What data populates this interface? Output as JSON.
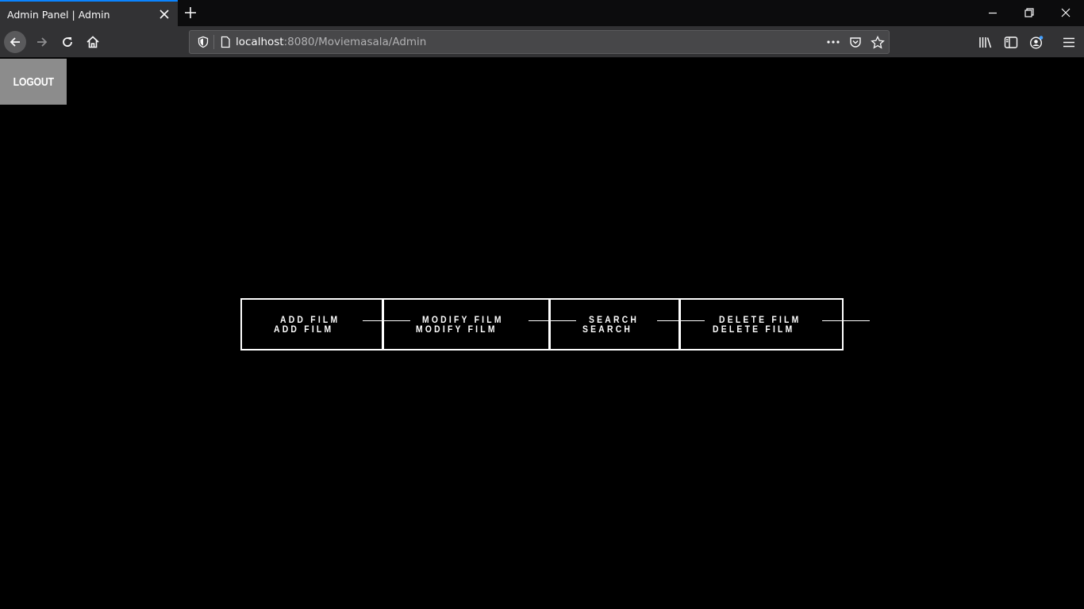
{
  "browser": {
    "tab_title": "Admin Panel | Admin",
    "url_host": "localhost",
    "url_rest": ":8080/Moviemasala/Admin",
    "accent": "#0a84ff"
  },
  "page": {
    "logout_label": "LOGOUT",
    "menu": [
      {
        "top": "ADD FILM",
        "bottom": "ADD FILM"
      },
      {
        "top": "MODIFY FILM",
        "bottom": "MODIFY FILM"
      },
      {
        "top": "SEARCH",
        "bottom": "SEARCH"
      },
      {
        "top": "DELETE FILM",
        "bottom": "DELETE FILM"
      }
    ]
  }
}
